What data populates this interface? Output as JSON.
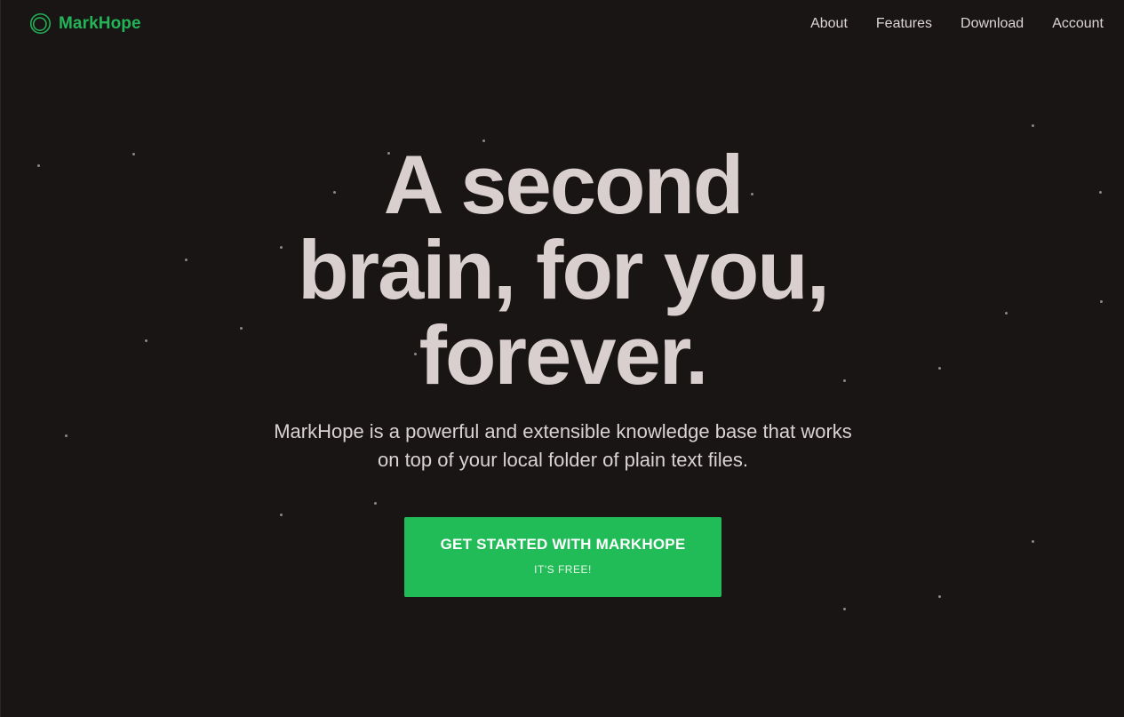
{
  "header": {
    "brand_name": "MarkHope",
    "brand_icon": "markhope-logo-icon",
    "nav": [
      {
        "label": "About"
      },
      {
        "label": "Features"
      },
      {
        "label": "Download"
      },
      {
        "label": "Account"
      }
    ]
  },
  "hero": {
    "title": "A second brain, for you, forever.",
    "subtitle": "MarkHope is a powerful and extensible knowledge base that works on top of your local folder of plain text files.",
    "cta": {
      "label": "GET STARTED WITH MARKHOPE",
      "sublabel": "IT'S FREE!"
    }
  },
  "colors": {
    "background": "#191515",
    "brand": "#22b456",
    "cta_background": "#21bb58",
    "headline": "#dacfcf",
    "text": "#dad3d3"
  }
}
